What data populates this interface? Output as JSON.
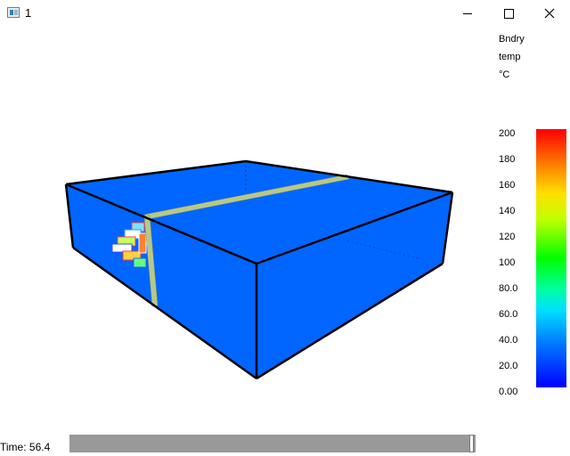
{
  "window": {
    "title": "1",
    "icon": "app-window-icon",
    "controls": [
      "minimize-icon",
      "maximize-icon",
      "close-icon"
    ]
  },
  "legend": {
    "header_lines": [
      "Bndry",
      "temp",
      "°C"
    ],
    "ticks": [
      "200",
      "180",
      "160",
      "140",
      "120",
      "100",
      "80.0",
      "60.0",
      "40.0",
      "20.0",
      "0.00"
    ],
    "range": [
      0,
      200
    ],
    "colors": [
      "#ff0000",
      "#ffe000",
      "#00ff00",
      "#00e0ff",
      "#0000ff"
    ]
  },
  "scene": {
    "box_color": "#0066ff",
    "edge_color": "#000000",
    "beam_color": "#b8c88a"
  },
  "time": {
    "label": "Time: 56.4"
  },
  "slider": {
    "position_fraction": 0.99
  }
}
